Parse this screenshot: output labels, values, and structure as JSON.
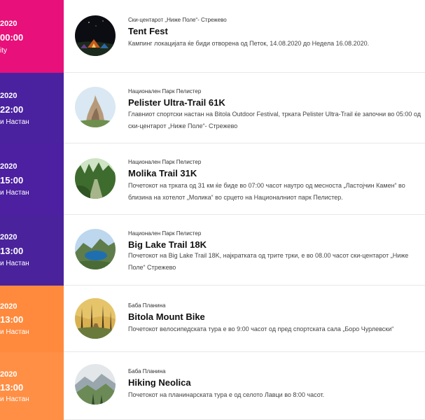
{
  "events": [
    {
      "panel_color": "#e8107a",
      "year": "2020",
      "time": "00:00",
      "type": "ity",
      "location": "Ски-центарот „Ниже Поле“- Стрежево",
      "title": "Tent Fest",
      "description": "Кампинг локацијата ќе биди отворена од Петок, 14.08.2020 до Недела 16.08.2020.",
      "image": "tent-night-image"
    },
    {
      "panel_color": "#4a22a0",
      "year": "2020",
      "time": "22:00",
      "type": "и Настан",
      "location": "Национален Парк Пелистер",
      "title": "Pelister Ultra-Trail 61K",
      "description": "Главниот спортски настан на Bitola Outdoor Festival, трката Pelister Ultra-Trail ќе започни во 05:00 од ски-центарот „Ниже Поле“- Стрежево",
      "image": "rock-peak-image"
    },
    {
      "panel_color": "#4c20a0",
      "year": "2020",
      "time": "15:00",
      "type": "и Настан",
      "location": "Национален Парк Пелистер",
      "title": "Molika Trail 31K",
      "description": "Почетокот на трката од 31 км ќе биде во 07:00 часот наутро од месноста „Ластојчин Камен“ во близина на хотелот „Молика“ во срцето на Националниот парк Пелистер.",
      "image": "forest-trail-image"
    },
    {
      "panel_color": "#4a239c",
      "year": "2020",
      "time": "13:00",
      "type": "и Настан",
      "location": "Национален Парк Пелистер",
      "title": "Big Lake Trail 18K",
      "description": "Почетокот на Big Lake Trail 18K, најкратката од трите трки, е во 08.00 часот ски-центарот „Ниже Поле“ Стрежево",
      "image": "mountain-lake-image"
    },
    {
      "panel_color": "#ff8a3d",
      "year": "2020",
      "time": "13:00",
      "type": "и Настан",
      "location": "Баба Планина",
      "title": "Bitola Mount Bike",
      "description": "Почетокот велосипедската тура е во 9:00 часот од пред спортската сала „Боро Чурлевски“",
      "image": "autumn-forest-image"
    },
    {
      "panel_color": "#ff8f45",
      "year": "2020",
      "time": "13:00",
      "type": "и Настан",
      "location": "Баба Планина",
      "title": "Hiking Neolica",
      "description": "Почетокот на планинарската тура е од селото Лавци во 8:00 часот.",
      "image": "misty-mountain-image"
    }
  ]
}
